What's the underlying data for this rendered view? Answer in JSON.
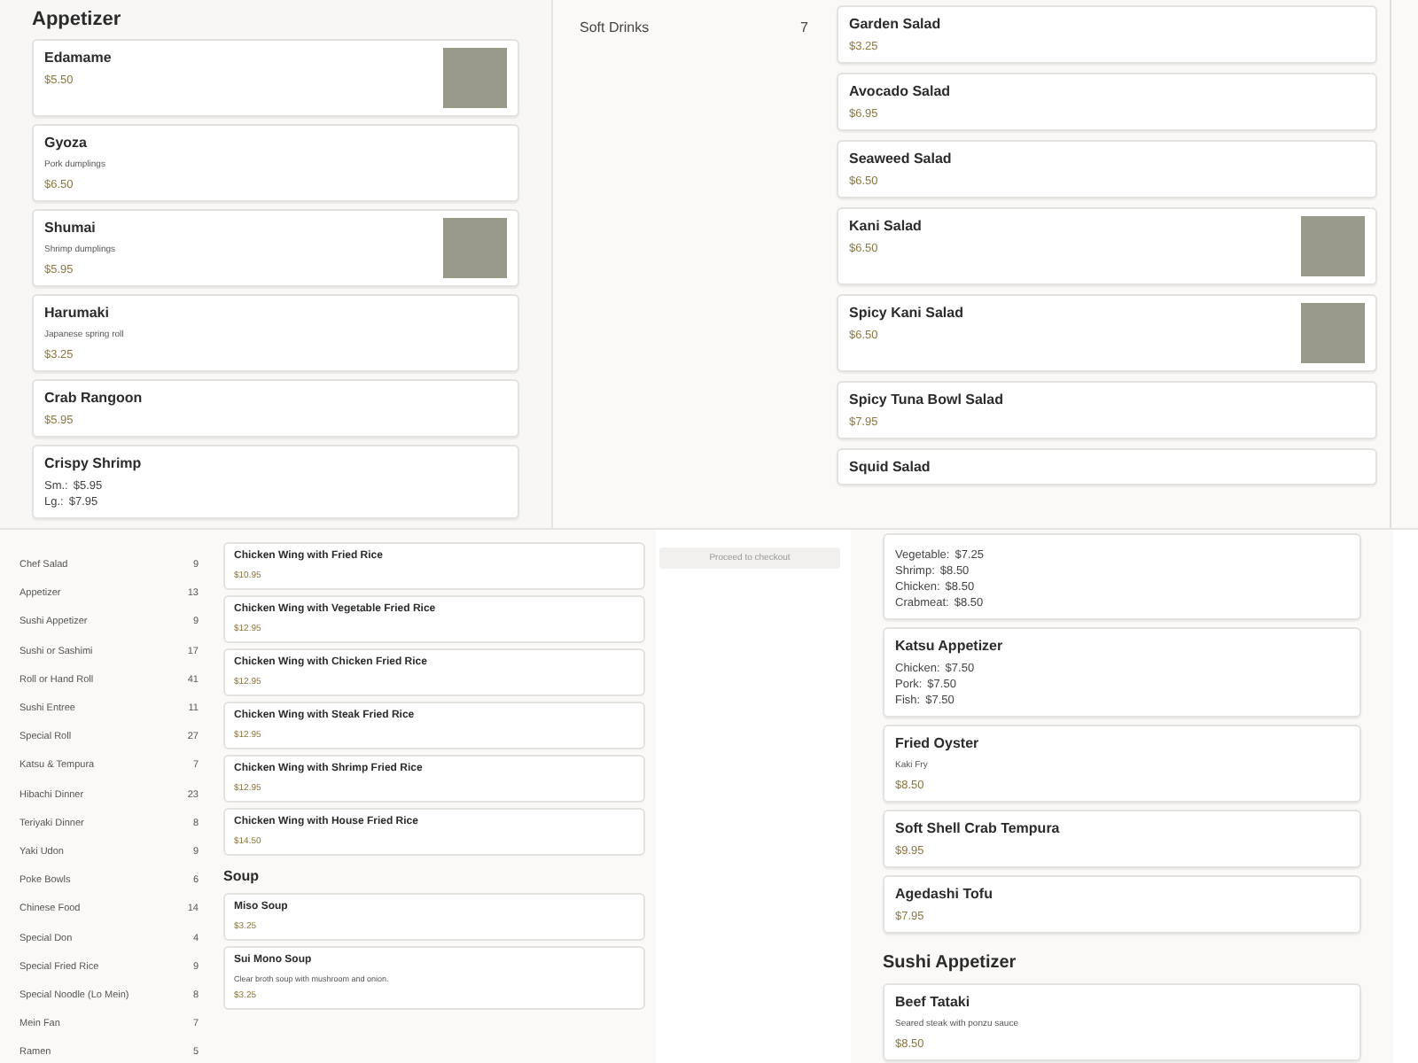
{
  "appetizer_panel": {
    "heading": "Appetizer",
    "items": [
      {
        "name": "Edamame",
        "price": "$5.50",
        "photo": true
      },
      {
        "name": "Gyoza",
        "description": "Pork dumplings",
        "price": "$6.50",
        "photo": false
      },
      {
        "name": "Shumai",
        "description": "Shrimp dumplings",
        "price": "$5.95",
        "photo": true
      },
      {
        "name": "Harumaki",
        "description": "Japanese spring roll",
        "price": "$3.25",
        "photo": false
      },
      {
        "name": "Crab Rangoon",
        "price": "$5.95",
        "photo": false
      },
      {
        "name": "Crispy Shrimp",
        "options": [
          {
            "label": "Sm.:",
            "price": "$5.95"
          },
          {
            "label": "Lg.:",
            "price": "$7.95"
          }
        ],
        "photo": false
      }
    ]
  },
  "salad_panel": {
    "sidebar_items": [
      {
        "name": "Soft Drinks",
        "count": "7"
      }
    ],
    "items": [
      {
        "name": "Garden Salad",
        "price": "$3.25",
        "photo": false
      },
      {
        "name": "Avocado Salad",
        "price": "$6.95",
        "photo": false
      },
      {
        "name": "Seaweed Salad",
        "price": "$6.50",
        "photo": false
      },
      {
        "name": "Kani Salad",
        "price": "$6.50",
        "photo": true
      },
      {
        "name": "Spicy Kani Salad",
        "price": "$6.50",
        "photo": true
      },
      {
        "name": "Spicy Tuna Bowl Salad",
        "price": "$7.95",
        "photo": false
      },
      {
        "name": "Squid Salad",
        "photo": false
      }
    ]
  },
  "category_panel": {
    "sidebar_items": [
      {
        "name": "Chef Salad",
        "count": "9"
      },
      {
        "name": "Appetizer",
        "count": "13"
      },
      {
        "name": "Sushi Appetizer",
        "count": "9"
      },
      {
        "name": "Sushi or Sashimi",
        "count": "17"
      },
      {
        "name": "Roll or Hand Roll",
        "count": "41"
      },
      {
        "name": "Sushi Entree",
        "count": "11"
      },
      {
        "name": "Special Roll",
        "count": "27"
      },
      {
        "name": "Katsu & Tempura",
        "count": "7"
      },
      {
        "name": "Hibachi Dinner",
        "count": "23"
      },
      {
        "name": "Teriyaki Dinner",
        "count": "8"
      },
      {
        "name": "Yaki Udon",
        "count": "9"
      },
      {
        "name": "Poke Bowls",
        "count": "6"
      },
      {
        "name": "Chinese Food",
        "count": "14"
      },
      {
        "name": "Special Don",
        "count": "4"
      },
      {
        "name": "Special Fried Rice",
        "count": "9"
      },
      {
        "name": "Special Noodle (Lo Mein)",
        "count": "8"
      },
      {
        "name": "Mein Fan",
        "count": "7"
      },
      {
        "name": "Ramen",
        "count": "5"
      }
    ],
    "sections": [
      {
        "items": [
          {
            "name": "Chicken Wing with Fried Rice",
            "price": "$10.95",
            "photo": false
          },
          {
            "name": "Chicken Wing with Vegetable Fried Rice",
            "price": "$12.95",
            "photo": false
          },
          {
            "name": "Chicken Wing with Chicken Fried Rice",
            "price": "$12.95",
            "photo": false
          },
          {
            "name": "Chicken Wing with Steak Fried Rice",
            "price": "$12.95",
            "photo": false
          },
          {
            "name": "Chicken Wing with Shrimp Fried Rice",
            "price": "$12.95",
            "photo": false
          },
          {
            "name": "Chicken Wing with House Fried Rice",
            "price": "$14.50",
            "photo": false
          }
        ]
      },
      {
        "heading": "Soup",
        "items": [
          {
            "name": "Miso Soup",
            "price": "$3.25",
            "photo": false
          },
          {
            "name": "Sui Mono Soup",
            "description": "Clear broth soup with mushroom and onion.",
            "price": "$3.25",
            "photo": false
          }
        ]
      }
    ]
  },
  "appetizer_list_panel": {
    "checkout_button": "Proceed to checkout",
    "sections": [
      {
        "items": [
          {
            "options": [
              {
                "label": "Vegetable:",
                "price": "$7.25"
              },
              {
                "label": "Shrimp:",
                "price": "$8.50"
              },
              {
                "label": "Chicken:",
                "price": "$8.50"
              },
              {
                "label": "Crabmeat:",
                "price": "$8.50"
              }
            ],
            "photo": false
          },
          {
            "name": "Katsu Appetizer",
            "options": [
              {
                "label": "Chicken:",
                "price": "$7.50"
              },
              {
                "label": "Pork:",
                "price": "$7.50"
              },
              {
                "label": "Fish:",
                "price": "$7.50"
              }
            ],
            "photo": false
          },
          {
            "name": "Fried Oyster",
            "description": "Kaki Fry",
            "price": "$8.50",
            "photo": false
          },
          {
            "name": "Soft Shell Crab Tempura",
            "price": "$9.95",
            "photo": false
          },
          {
            "name": "Agedashi Tofu",
            "price": "$7.95",
            "photo": false
          }
        ]
      },
      {
        "heading": "Sushi Appetizer",
        "items": [
          {
            "name": "Beef Tataki",
            "description": "Seared steak with ponzu sauce",
            "price": "$8.50",
            "photo": false
          }
        ]
      }
    ]
  }
}
